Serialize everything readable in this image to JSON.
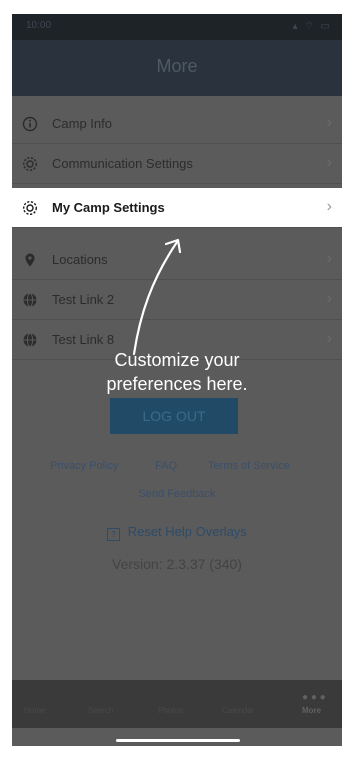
{
  "status": {
    "time": "10:00",
    "icons": "▴ ⌔ ▭"
  },
  "nav": {
    "title": "More"
  },
  "menu": {
    "items": [
      {
        "label": "Camp Info",
        "icon": "info-icon"
      },
      {
        "label": "Communication Settings",
        "icon": "gear-icon"
      },
      {
        "label": "My Camp Settings",
        "icon": "gear-icon",
        "highlighted": true
      },
      {
        "label": "Locations",
        "icon": "map-pin-icon"
      },
      {
        "label": "Test Link 2",
        "icon": "globe-icon"
      },
      {
        "label": "Test Link 8",
        "icon": "globe-icon"
      }
    ]
  },
  "callout": {
    "line1": "Customize your",
    "line2": "preferences here."
  },
  "actions": {
    "logout_label": "LOG OUT",
    "privacy_policy": "Privacy Policy",
    "faq": "FAQ",
    "terms": "Terms of Service",
    "send_feedback": "Send Feedback",
    "reset_help": "Reset Help Overlays",
    "version": "Version: 2.3.37 (340)"
  },
  "tabbar": {
    "tabs": [
      "Home",
      "Search",
      "Photos",
      "Calendar",
      "More"
    ]
  },
  "colors": {
    "overlay": "#5b5b5b",
    "highlight": "#ffffff",
    "nav": "#2a333d",
    "logout": "#214a66"
  }
}
